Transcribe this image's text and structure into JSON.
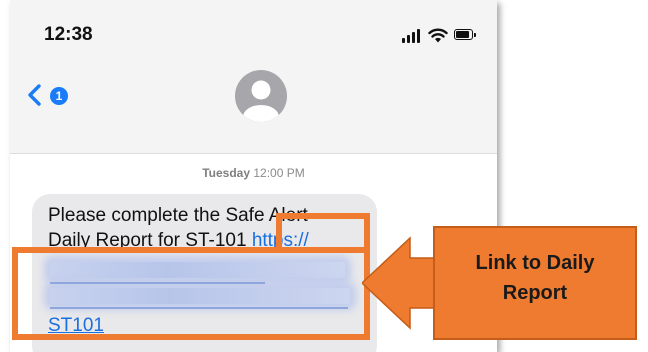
{
  "status_bar": {
    "time": "12:38"
  },
  "header": {
    "back_badge": "1",
    "back_icon": "chevron-left-icon",
    "avatar_icon": "person-avatar-icon"
  },
  "conversation": {
    "timestamp_day": "Tuesday",
    "timestamp_time": "12:00 PM",
    "message": {
      "text_line1": "Please complete the Safe Alert",
      "text_line2": "Daily Report for ST-101 ",
      "link_start": "https://",
      "link_end": "ST101"
    }
  },
  "annotation": {
    "callout_line1": "Link to Daily",
    "callout_line2": "Report",
    "color": "#ee7b30"
  },
  "colors": {
    "link": "#1a6fe0",
    "bubble": "#e9e9eb",
    "badge": "#1a7cf6"
  }
}
